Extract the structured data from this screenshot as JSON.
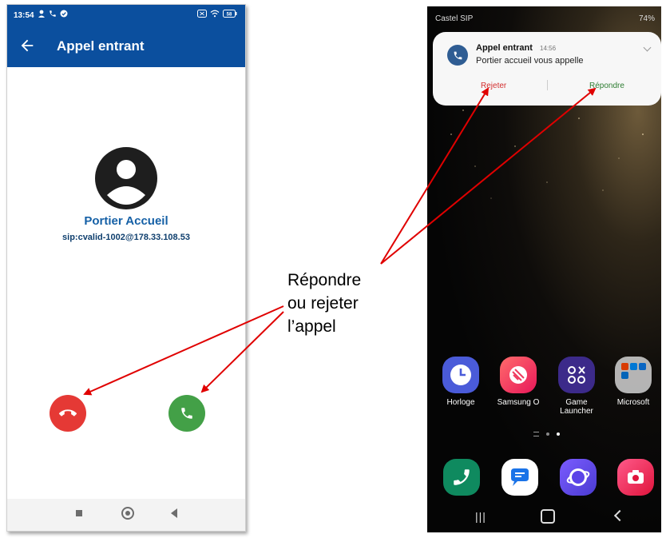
{
  "left_phone": {
    "status_time": "13:54",
    "battery": "58",
    "title": "Appel entrant",
    "caller_name": "Portier Accueil",
    "caller_sip": "sip:cvalid-1002@178.33.108.53"
  },
  "right_phone": {
    "carrier": "Castel SIP",
    "battery": "74%",
    "notification": {
      "title": "Appel entrant",
      "time": "14:56",
      "text": "Portier accueil vous appelle",
      "reject_label": "Rejeter",
      "answer_label": "Répondre"
    },
    "apps": [
      {
        "label": "Horloge"
      },
      {
        "label": "Samsung O"
      },
      {
        "label": "Game Launcher"
      },
      {
        "label": "Microsoft"
      }
    ]
  },
  "annotation": {
    "line1": "Répondre",
    "line2": "ou rejeter",
    "line3": "l’appel"
  },
  "colors": {
    "app_bar": "#0b4f9e",
    "reject": "#e53935",
    "accept": "#43a047",
    "arrow": "#e00000"
  }
}
